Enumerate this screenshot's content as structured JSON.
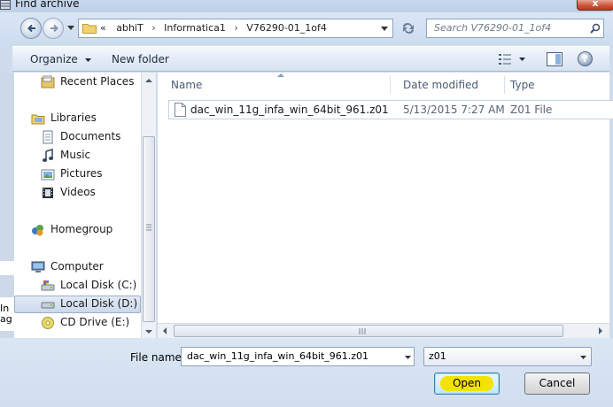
{
  "window": {
    "title": "Find archive",
    "close_label": "x"
  },
  "address_bar": {
    "overflow": "«",
    "crumbs": [
      "abhiT",
      "Informatica1",
      "V76290-01_1of4"
    ],
    "separator": "›"
  },
  "search": {
    "placeholder": "Search V76290-01_1of4"
  },
  "toolbar": {
    "organize_label": "Organize",
    "new_folder_label": "New folder",
    "help_label": "?"
  },
  "nav_pane": {
    "items": [
      {
        "label": "Recent Places",
        "icon": "recent-places-icon"
      },
      {
        "label": "Libraries",
        "icon": "libraries-icon"
      },
      {
        "label": "Documents",
        "icon": "documents-icon"
      },
      {
        "label": "Music",
        "icon": "music-icon"
      },
      {
        "label": "Pictures",
        "icon": "pictures-icon"
      },
      {
        "label": "Videos",
        "icon": "videos-icon"
      },
      {
        "label": "Homegroup",
        "icon": "homegroup-icon"
      },
      {
        "label": "Computer",
        "icon": "computer-icon"
      },
      {
        "label": "Local Disk (C:)",
        "icon": "local-disk-icon"
      },
      {
        "label": "Local Disk (D:)",
        "icon": "local-disk-icon",
        "selected": true
      },
      {
        "label": "CD Drive (E:)",
        "icon": "cd-drive-icon"
      }
    ]
  },
  "file_list": {
    "columns": [
      "Name",
      "Date modified",
      "Type"
    ],
    "rows": [
      {
        "name": "dac_win_11g_infa_win_64bit_961.z01",
        "date": "5/13/2015 7:27 AM",
        "type": "Z01 File"
      }
    ]
  },
  "bottom": {
    "file_name_label": "File name:",
    "file_name_value": "dac_win_11g_infa_win_64bit_961.z01",
    "file_type_value": "z01",
    "open_label": "Open",
    "cancel_label": "Cancel"
  },
  "background_fragment": {
    "line1": "In",
    "line2": "ag"
  },
  "colors": {
    "highlight": "#f4e205",
    "accent": "#3c7fb1"
  }
}
